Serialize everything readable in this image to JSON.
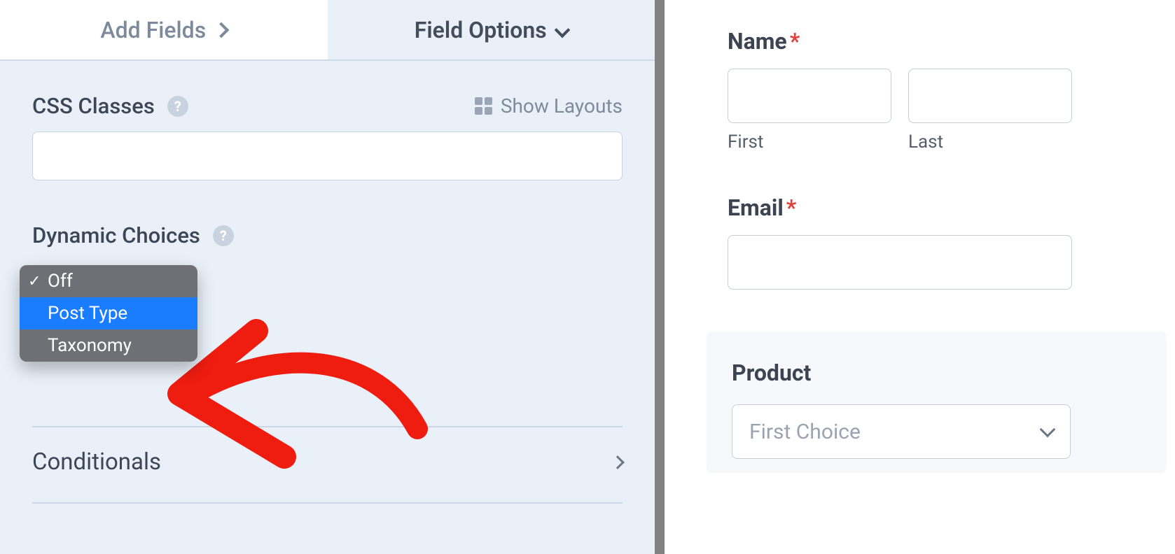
{
  "tabs": {
    "add_fields": "Add Fields",
    "field_options": "Field Options"
  },
  "css_section": {
    "label": "CSS Classes",
    "show_layouts": "Show Layouts",
    "value": ""
  },
  "dynamic_choices": {
    "label": "Dynamic Choices",
    "options": [
      "Off",
      "Post Type",
      "Taxonomy"
    ],
    "selected": "Off",
    "highlighted": "Post Type"
  },
  "conditionals": {
    "label": "Conditionals"
  },
  "preview": {
    "name": {
      "label": "Name",
      "first_sub": "First",
      "last_sub": "Last"
    },
    "email": {
      "label": "Email"
    },
    "product": {
      "label": "Product",
      "placeholder": "First Choice"
    }
  }
}
